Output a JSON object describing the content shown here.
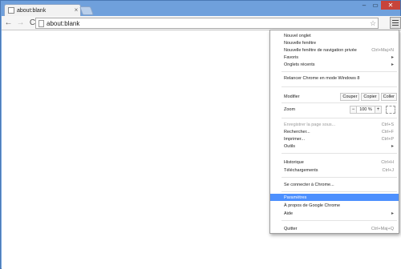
{
  "tab": {
    "title": "about:blank",
    "close": "×"
  },
  "window": {
    "minimize": "–",
    "maximize": "▭",
    "close": "✕"
  },
  "toolbar": {
    "back": "←",
    "forward": "→",
    "reload": "C",
    "url": "about:blank",
    "star": "☆"
  },
  "menu": {
    "items_top": [
      {
        "label": "Nouvel onglet",
        "shortcut": ""
      },
      {
        "label": "Nouvelle fenêtre",
        "shortcut": ""
      },
      {
        "label": "Nouvelle fenêtre de navigation privée",
        "shortcut": "Ctrl+Maj+N"
      },
      {
        "label": "Favoris",
        "shortcut": ""
      },
      {
        "label": "Onglets récents",
        "shortcut": ""
      }
    ],
    "relaunch": "Relancer Chrome en mode Windows 8",
    "edit": {
      "label": "Modifier",
      "cut": "Couper",
      "copy": "Copier",
      "paste": "Coller"
    },
    "zoom": {
      "label": "Zoom",
      "minus": "−",
      "value": "100 %",
      "plus": "+"
    },
    "items_mid": [
      {
        "label": "Enregistrer la page sous...",
        "shortcut": "Ctrl+S"
      },
      {
        "label": "Rechercher...",
        "shortcut": "Ctrl+F"
      },
      {
        "label": "Imprimer...",
        "shortcut": "Ctrl+P"
      },
      {
        "label": "Outils",
        "shortcut": ""
      }
    ],
    "items_hist": [
      {
        "label": "Historique",
        "shortcut": "Ctrl+H"
      },
      {
        "label": "Téléchargements",
        "shortcut": "Ctrl+J"
      }
    ],
    "signin": "Se connecter à Chrome...",
    "items_bottom": [
      {
        "label": "Paramètres",
        "shortcut": ""
      },
      {
        "label": "À propos de Google Chrome",
        "shortcut": ""
      },
      {
        "label": "Aide",
        "shortcut": ""
      }
    ],
    "quit": {
      "label": "Quitter",
      "shortcut": "Ctrl+Maj+Q"
    },
    "submenu_arrow": "▸"
  },
  "colors": {
    "frame": "#6fa0dc",
    "selected": "#4d90fe",
    "close_button": "#c7443a"
  }
}
